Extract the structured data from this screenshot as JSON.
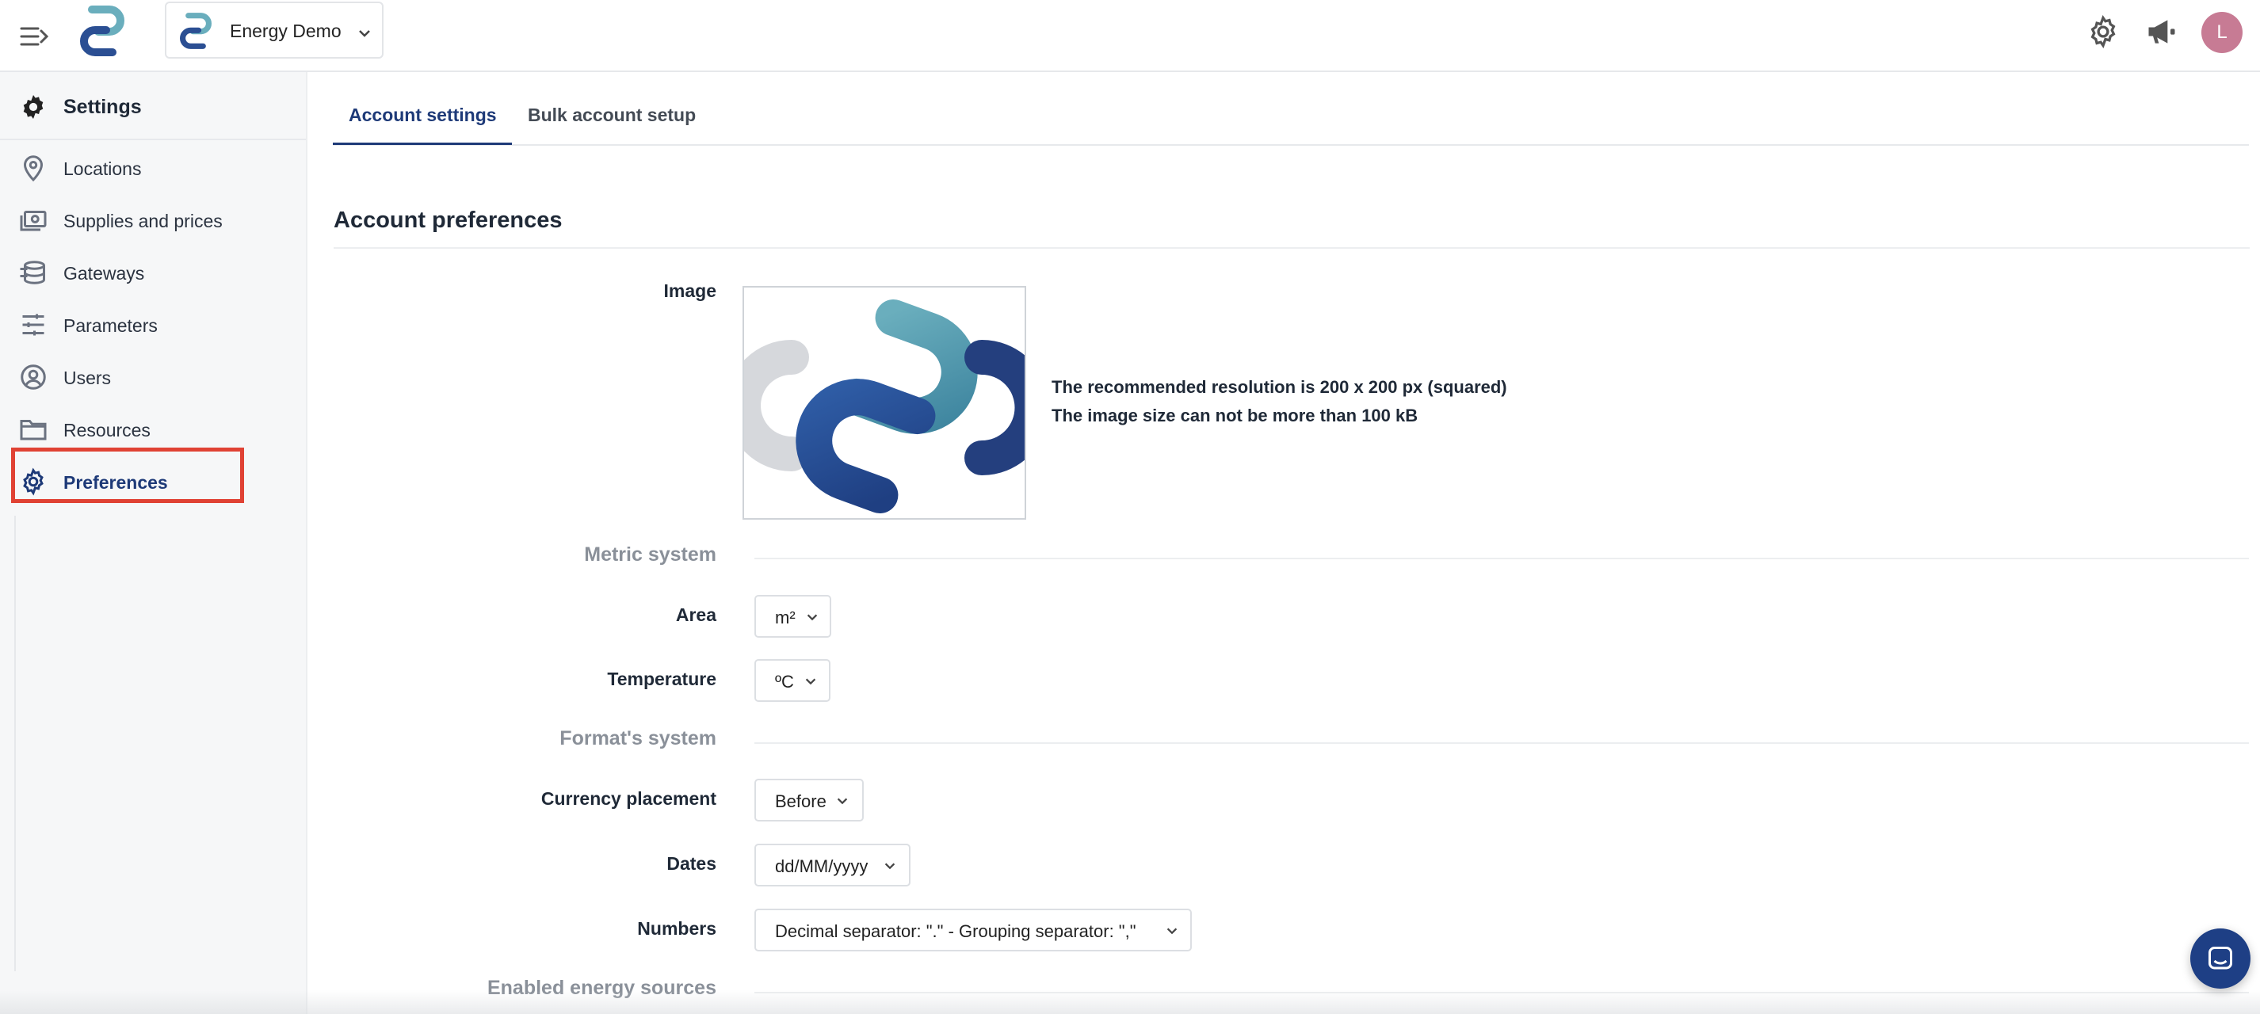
{
  "header": {
    "workspace_name": "Energy Demo",
    "avatar_initial": "L",
    "icons": [
      "menu-expand-icon",
      "app-logo",
      "chevron-down-icon",
      "gear-icon",
      "megaphone-icon"
    ]
  },
  "sidebar": {
    "title": "Settings",
    "items": [
      {
        "label": "Locations",
        "icon": "map-pin-icon"
      },
      {
        "label": "Supplies and prices",
        "icon": "money-icon"
      },
      {
        "label": "Gateways",
        "icon": "gateway-icon"
      },
      {
        "label": "Parameters",
        "icon": "sliders-icon"
      },
      {
        "label": "Users",
        "icon": "user-circle-icon"
      },
      {
        "label": "Resources",
        "icon": "folder-icon"
      },
      {
        "label": "Preferences",
        "icon": "gear-icon",
        "active": true
      }
    ]
  },
  "tabs": [
    {
      "label": "Account settings",
      "active": true
    },
    {
      "label": "Bulk account setup",
      "active": false
    }
  ],
  "section": {
    "title": "Account preferences",
    "image_label": "Image",
    "image_note_1": "The recommended resolution is 200 x 200 px (squared)",
    "image_note_2": "The image size can not be more than 100 kB"
  },
  "metric": {
    "group_label": "Metric system",
    "area_label": "Area",
    "area_value": "m²",
    "temperature_label": "Temperature",
    "temperature_value": "ºC"
  },
  "format": {
    "group_label": "Format's system",
    "currency_label": "Currency placement",
    "currency_value": "Before",
    "dates_label": "Dates",
    "dates_value": "dd/MM/yyyy",
    "numbers_label": "Numbers",
    "numbers_value": "Decimal separator: \".\" - Grouping separator: \",\""
  },
  "energy": {
    "group_label": "Enabled energy sources"
  },
  "colors": {
    "accent": "#1e3a78",
    "highlight": "#e04234",
    "avatar": "#c77b94",
    "chat": "#1e3f85"
  }
}
